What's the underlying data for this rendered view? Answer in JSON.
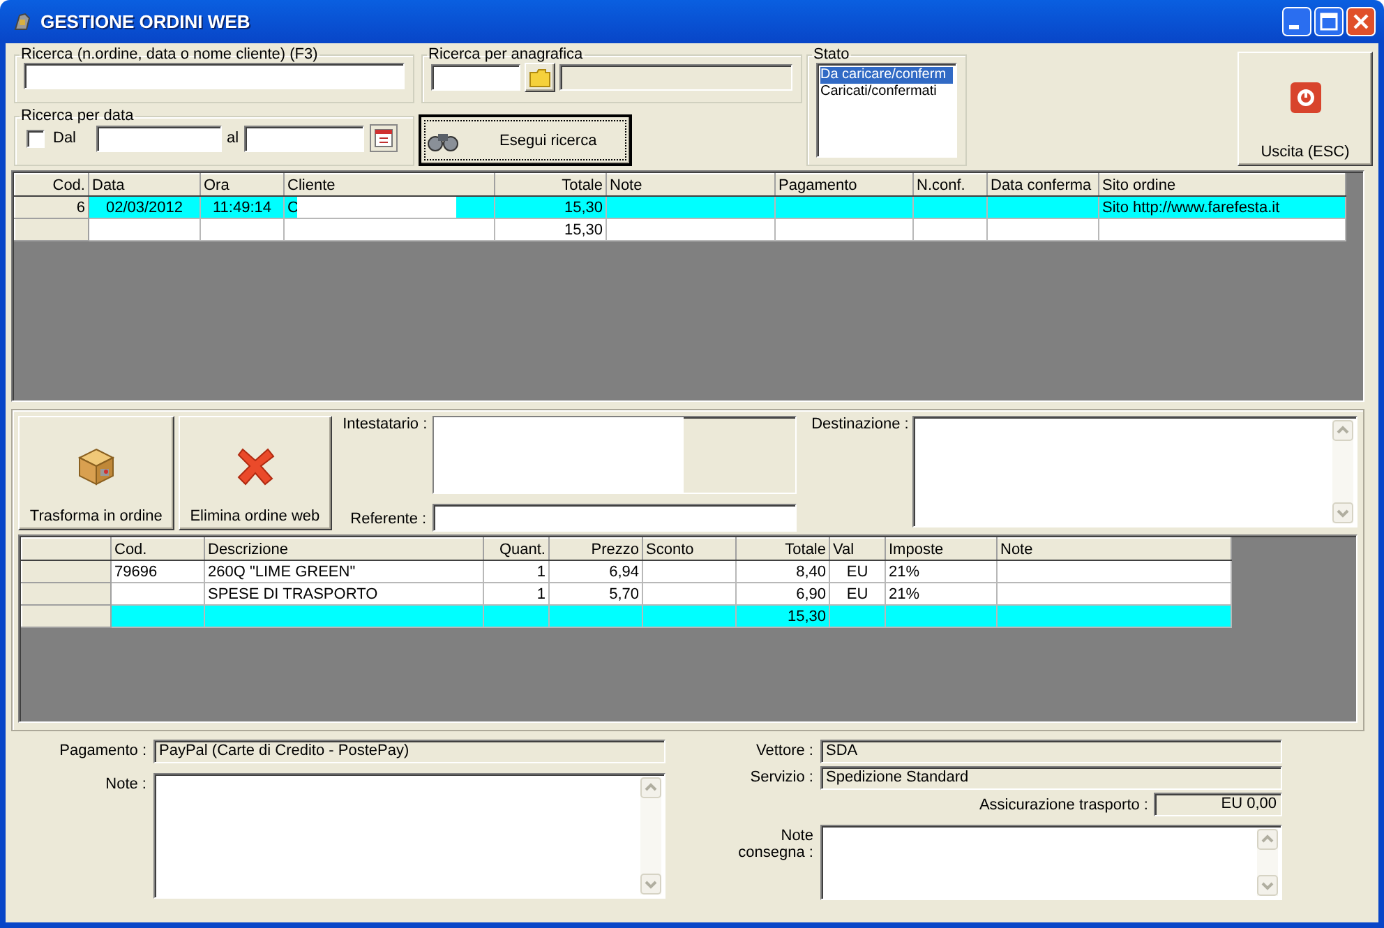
{
  "window": {
    "title": "GESTIONE ORDINI WEB"
  },
  "search": {
    "text_search": {
      "label": "Ricerca (n.ordine, data o nome cliente) (F3)"
    },
    "registry_search": {
      "label": "Ricerca per anagrafica"
    },
    "date_search": {
      "label": "Ricerca per data",
      "checkbox_label": "Dal",
      "checked": false,
      "to_label": "al"
    },
    "run_button": "Esegui ricerca"
  },
  "status": {
    "label": "Stato",
    "items": [
      {
        "label": "Da caricare/conferm",
        "selected": true
      },
      {
        "label": "Caricati/confermati",
        "selected": false
      }
    ]
  },
  "exit_button": "Uscita (ESC)",
  "orders": {
    "columns": [
      "Cod.",
      "Data",
      "Ora",
      "Cliente",
      "Totale",
      "Note",
      "Pagamento",
      "N.conf.",
      "Data conferma",
      "Sito ordine"
    ],
    "rows": [
      {
        "selected": true,
        "redacted": true,
        "cells": [
          "6",
          "02/03/2012",
          "11:49:14",
          "C",
          "15,30",
          null,
          null,
          null,
          null,
          "Sito http://www.farefesta.it"
        ]
      },
      {
        "selected": false,
        "cells": [
          null,
          null,
          null,
          null,
          "15,30",
          null,
          null,
          null,
          null,
          null
        ]
      }
    ]
  },
  "actions": [
    "Trasforma in ordine",
    "Elimina ordine web"
  ],
  "holder": {
    "label": "Intestatario :",
    "redacted": true
  },
  "contact": {
    "label": "Referente :"
  },
  "destination": {
    "label": "Destinazione :"
  },
  "lines": {
    "columns": [
      "Cod.",
      "Descrizione",
      "Quant.",
      "Prezzo",
      "Sconto",
      "Totale",
      "Val",
      "Imposte",
      "Note"
    ],
    "rows": [
      {
        "selected": false,
        "cells": [
          "79696",
          "260Q \"LIME GREEN\"",
          "1",
          "6,94",
          null,
          "8,40",
          "EU",
          "21%",
          null
        ]
      },
      {
        "selected": false,
        "cells": [
          null,
          "SPESE DI TRASPORTO",
          "1",
          "5,70",
          null,
          "6,90",
          "EU",
          "21%",
          null
        ]
      },
      {
        "selected": true,
        "cells": [
          null,
          null,
          null,
          null,
          null,
          "15,30",
          null,
          null,
          null
        ]
      }
    ]
  },
  "payment": {
    "label": "Pagamento :",
    "value": "PayPal (Carte di Credito - PostePay)"
  },
  "note": {
    "label": "Note :"
  },
  "carrier": {
    "label": "Vettore :",
    "value": "SDA"
  },
  "service": {
    "label": "Servizio :",
    "value": "Spedizione Standard"
  },
  "insurance": {
    "label": "Assicurazione trasporto :",
    "value": "EU 0,00"
  },
  "delivery_note": {
    "label": "Note consegna :"
  }
}
